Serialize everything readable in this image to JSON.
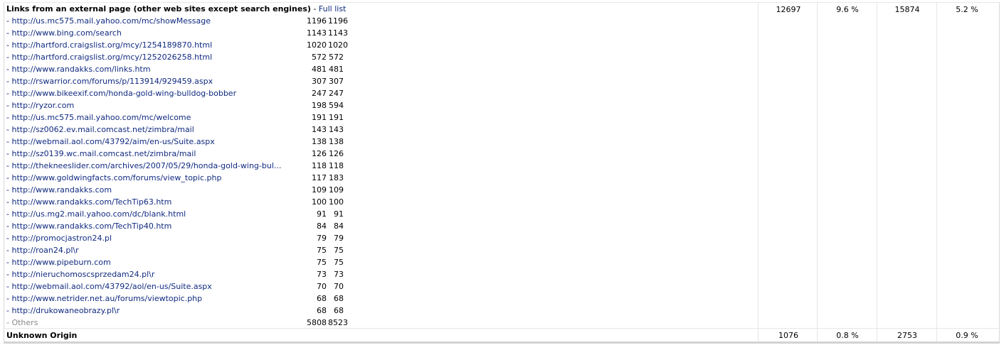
{
  "external": {
    "title": "Links from an external page (other web sites except search engines)",
    "separator": " - ",
    "full_list_label": "Full list",
    "pages": "12697",
    "pages_pct": "9.6 %",
    "hits": "15874",
    "hits_pct": "5.2 %",
    "rows": [
      {
        "url": "- http://us.mc575.mail.yahoo.com/mc/showMessage",
        "pages": "1196",
        "hits": "1196"
      },
      {
        "url": "- http://www.bing.com/search",
        "pages": "1143",
        "hits": "1143"
      },
      {
        "url": "- http://hartford.craigslist.org/mcy/1254189870.html",
        "pages": "1020",
        "hits": "1020"
      },
      {
        "url": "- http://hartford.craigslist.org/mcy/1252026258.html",
        "pages": "572",
        "hits": "572"
      },
      {
        "url": "- http://www.randakks.com/links.htm",
        "pages": "481",
        "hits": "481"
      },
      {
        "url": "- http://rswarrior.com/forums/p/113914/929459.aspx",
        "pages": "307",
        "hits": "307"
      },
      {
        "url": "- http://www.bikeexif.com/honda-gold-wing-bulldog-bobber",
        "pages": "247",
        "hits": "247"
      },
      {
        "url": "- http://ryzor.com",
        "pages": "198",
        "hits": "594"
      },
      {
        "url": "- http://us.mc575.mail.yahoo.com/mc/welcome",
        "pages": "191",
        "hits": "191"
      },
      {
        "url": "- http://sz0062.ev.mail.comcast.net/zimbra/mail",
        "pages": "143",
        "hits": "143"
      },
      {
        "url": "- http://webmail.aol.com/43792/aim/en-us/Suite.aspx",
        "pages": "138",
        "hits": "138"
      },
      {
        "url": "- http://sz0139.wc.mail.comcast.net/zimbra/mail",
        "pages": "126",
        "hits": "126"
      },
      {
        "url": "- http://thekneeslider.com/archives/2007/05/29/honda-gold-wing-bul...",
        "pages": "118",
        "hits": "118"
      },
      {
        "url": "- http://www.goldwingfacts.com/forums/view_topic.php",
        "pages": "117",
        "hits": "183"
      },
      {
        "url": "- http://www.randakks.com",
        "pages": "109",
        "hits": "109"
      },
      {
        "url": "- http://www.randakks.com/TechTip63.htm",
        "pages": "100",
        "hits": "100"
      },
      {
        "url": "- http://us.mg2.mail.yahoo.com/dc/blank.html",
        "pages": "91",
        "hits": "91"
      },
      {
        "url": "- http://www.randakks.com/TechTip40.htm",
        "pages": "84",
        "hits": "84"
      },
      {
        "url": "- http://promocjastron24.pl",
        "pages": "79",
        "hits": "79"
      },
      {
        "url": "- http://roan24.pl\\r",
        "pages": "75",
        "hits": "75"
      },
      {
        "url": "- http://www.pipeburn.com",
        "pages": "75",
        "hits": "75"
      },
      {
        "url": "- http://nieruchomoscsprzedam24.pl\\r",
        "pages": "73",
        "hits": "73"
      },
      {
        "url": "- http://webmail.aol.com/43792/aol/en-us/Suite.aspx",
        "pages": "70",
        "hits": "70"
      },
      {
        "url": "- http://www.netrider.net.au/forums/viewtopic.php",
        "pages": "68",
        "hits": "68"
      },
      {
        "url": "- http://drukowaneobrazy.pl\\r",
        "pages": "68",
        "hits": "68"
      }
    ],
    "others": {
      "label": "- Others",
      "pages": "5808",
      "hits": "8523"
    }
  },
  "unknown": {
    "title": "Unknown Origin",
    "pages": "1076",
    "pages_pct": "0.8 %",
    "hits": "2753",
    "hits_pct": "0.9 %"
  },
  "colors": {
    "link": "#102a80",
    "others": "#8a8a8a",
    "grid": "#e6e6e6"
  }
}
